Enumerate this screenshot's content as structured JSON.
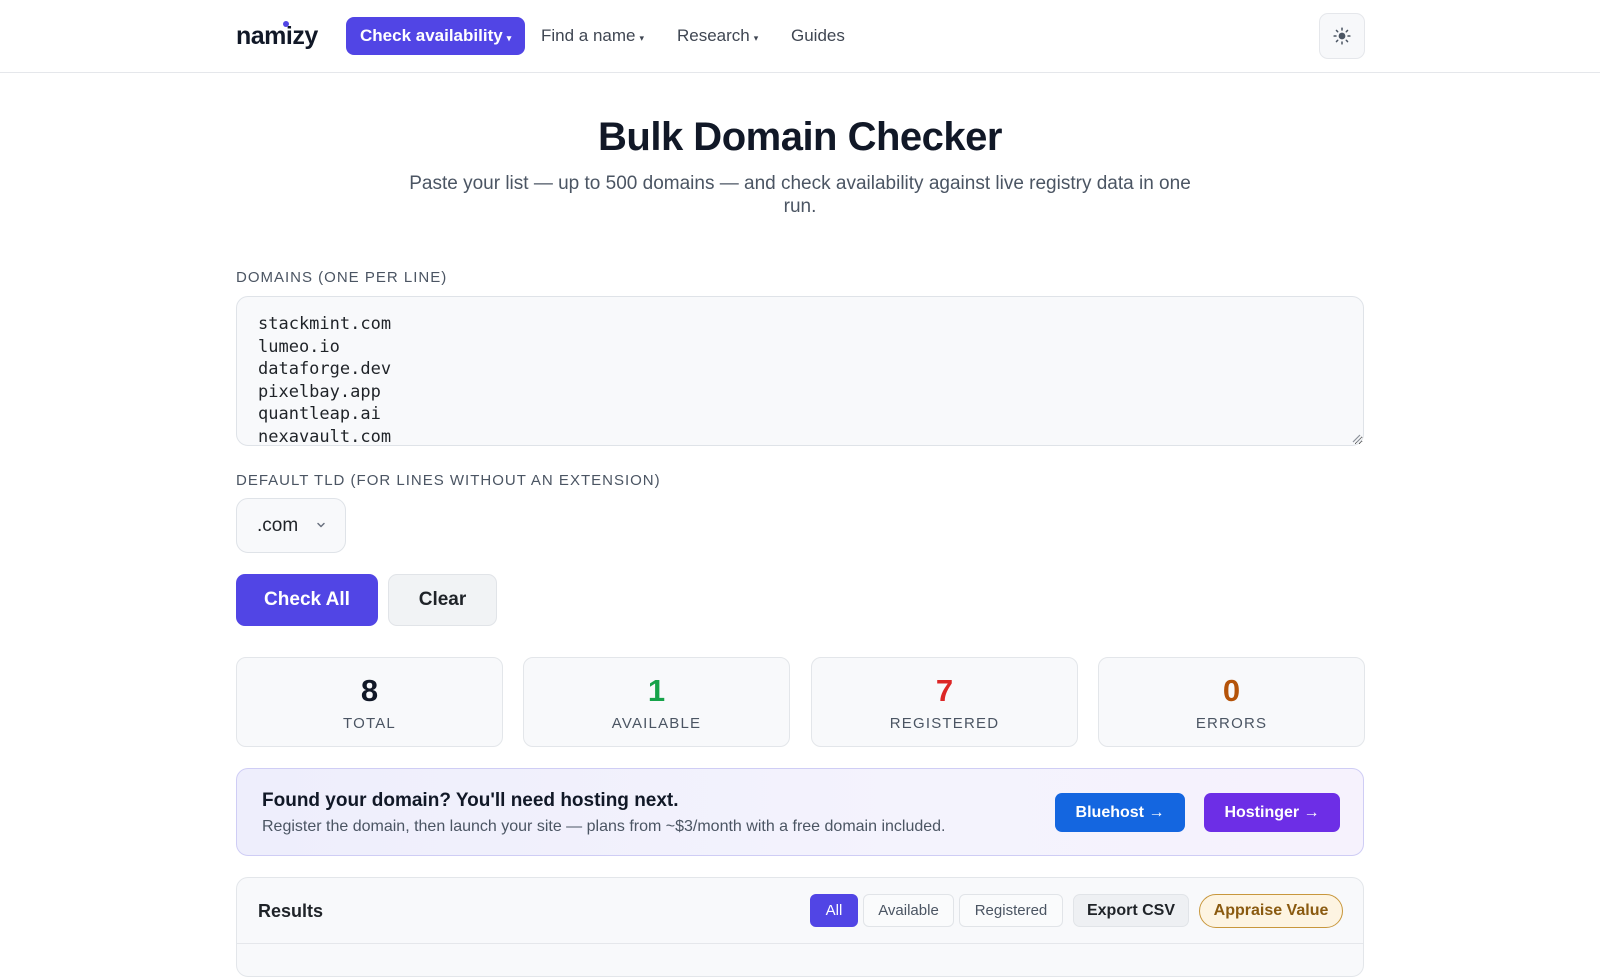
{
  "header": {
    "logo_text": "namizy",
    "nav": [
      {
        "label": "Check availability",
        "active": true,
        "has_dropdown": true
      },
      {
        "label": "Find a name",
        "has_dropdown": true
      },
      {
        "label": "Research",
        "has_dropdown": true
      },
      {
        "label": "Guides",
        "has_dropdown": false
      }
    ],
    "theme_icon": "sun-icon"
  },
  "page": {
    "title": "Bulk Domain Checker",
    "subtitle": "Paste your list — up to 500 domains — and check availability against live registry data in one run."
  },
  "form": {
    "domains_label": "DOMAINS (ONE PER LINE)",
    "domains_value": "stackmint.com\nlumeo.io\ndataforge.dev\npixelbay.app\nquantleap.ai\nnexavault.com",
    "tld_label": "DEFAULT TLD (FOR LINES WITHOUT AN EXTENSION)",
    "tld_selected": ".com",
    "check_all_label": "Check All",
    "clear_label": "Clear"
  },
  "stats": [
    {
      "value": "8",
      "label": "TOTAL",
      "color": "#111827"
    },
    {
      "value": "1",
      "label": "AVAILABLE",
      "color": "#16a34a"
    },
    {
      "value": "7",
      "label": "REGISTERED",
      "color": "#dc2626"
    },
    {
      "value": "0",
      "label": "ERRORS",
      "color": "#b45309"
    }
  ],
  "promo": {
    "title": "Found your domain? You'll need hosting next.",
    "text": "Register the domain, then launch your site — plans from ~$3/month with a free domain included.",
    "bluehost_label": "Bluehost →",
    "hostinger_label": "Hostinger →"
  },
  "results": {
    "title": "Results",
    "filters": [
      {
        "label": "All",
        "active": true
      },
      {
        "label": "Available",
        "active": false
      },
      {
        "label": "Registered",
        "active": false
      }
    ],
    "export_label": "Export CSV",
    "appraise_label": "Appraise Value"
  },
  "colors": {
    "accent": "#5145e5",
    "bluehost": "#1466e0",
    "hostinger": "#6d2ee6"
  }
}
